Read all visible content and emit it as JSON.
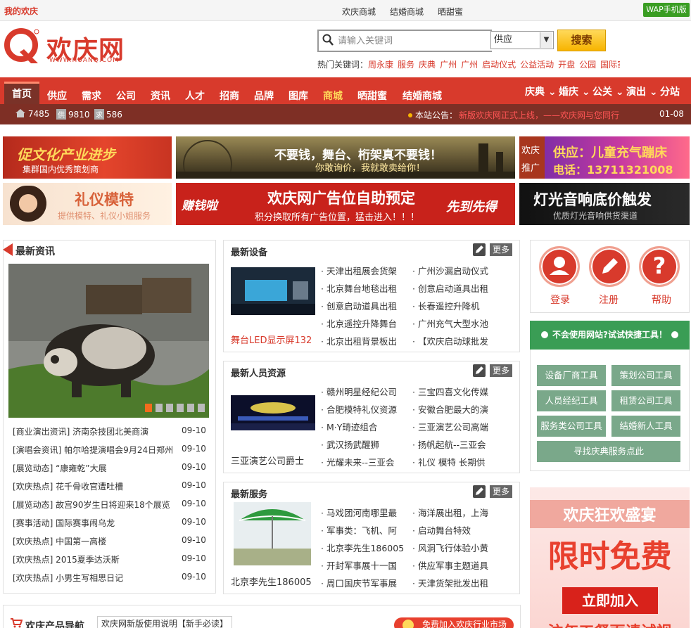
{
  "topbar": {
    "my_label": "我的欢庆",
    "links": [
      "欢庆商城",
      "结婚商城",
      "晒甜蜜"
    ],
    "wap": "WAP手机版"
  },
  "logo": {
    "text": "欢庆网",
    "url": "WWW.HUANQ.COM"
  },
  "search": {
    "placeholder": "请输入关键词",
    "category": "供应",
    "button": "搜索",
    "hot_label": "热门关键词：",
    "hot_keywords": [
      "周永康",
      "服务",
      "庆典",
      "广州",
      "广州",
      "启动仪式",
      "公益活动",
      "开盘",
      "公园",
      "国际家居"
    ]
  },
  "nav": {
    "items": [
      "首页",
      "供应",
      "需求",
      "公司",
      "资讯",
      "人才",
      "招商",
      "品牌",
      "图库",
      "商城",
      "晒甜蜜",
      "结婚商城"
    ],
    "right": [
      "庆典",
      "婚庆",
      "公关",
      "演出",
      "分站"
    ]
  },
  "stats": {
    "members": "7485",
    "supply_badge": "供",
    "supply": "9810",
    "demand_badge": "求",
    "demand": "586",
    "notice_label": "本站公告：",
    "notice_text": "新版欢庆网正式上线，——欢庆网与您同行",
    "notice_date": "01-08"
  },
  "banners": {
    "b1_title": "促文化产业进步",
    "b1_sub": "集群国内优秀策划商",
    "b2_title": "不要钱，舞台、桁架真不要钱！",
    "b2_sub": "你敢询价，我就敢卖给你！",
    "b3_tag1": "欢庆",
    "b3_tag2": "推广",
    "b3_title": "供应：儿童充气蹦床",
    "b3_sub": "电话：13711321008",
    "b4_title": "礼仪模特",
    "b4_sub": "提供模特、礼仪小姐服务",
    "b5_left": "赚钱啦",
    "b5_title": "欢庆网广告位自助预定",
    "b5_sub": "积分换取所有广告位置，猛击进入！！！",
    "b5_right": "先到先得",
    "b6_title": "灯光音响底价触发",
    "b6_sub": "优质灯光音响供货渠道"
  },
  "news": {
    "title": "最新资讯",
    "rows": [
      {
        "text": "[商业演出资讯] 济南杂技团北美商演",
        "date": "09-10"
      },
      {
        "text": "[演唱会资讯] 帕尔哈提演唱会9月24日郑州",
        "date": "09-10"
      },
      {
        "text": "[展览动态] “康雍乾”大展",
        "date": "09-10"
      },
      {
        "text": "[欢庆热点] 花千骨收官遭吐槽",
        "date": "09-10"
      },
      {
        "text": "[展览动态] 故宫90岁生日将迎来18个展览",
        "date": "09-10"
      },
      {
        "text": "[赛事活动] 国际赛事闹乌龙",
        "date": "09-10"
      },
      {
        "text": "[欢庆热点] 中国第一高楼",
        "date": "09-10"
      },
      {
        "text": "[欢庆热点] 2015夏季达沃斯",
        "date": "09-10"
      },
      {
        "text": "[欢庆热点] 小男生写相思日记",
        "date": "09-10"
      }
    ]
  },
  "equipment": {
    "title": "最新设备",
    "more": "更多",
    "caption": "舞台LED显示屏132",
    "col1": [
      "天津出租展会货架",
      "北京舞台地毯出租",
      "创意启动道具出租",
      "北京遥控升降舞台",
      "北京出租背景板出"
    ],
    "col2": [
      "广州沙漏启动仪式",
      "创意启动道具出租",
      "长春遥控升降机",
      "广州充气大型水池",
      "【欢庆启动球批发"
    ]
  },
  "people": {
    "title": "最新人员资源",
    "more": "更多",
    "caption": "三亚演艺公司爵士",
    "col1": [
      "赣州明星经纪公司",
      "合肥模特礼仪资源",
      "M·Y琦迹组合",
      "武汉扬武醒狮",
      "光耀未来--三亚会"
    ],
    "col2": [
      "三宝四喜文化传媒",
      "安徽合肥最大的演",
      "三亚演艺公司高端",
      "扬帆起航--三亚会",
      "礼仪 模特 长期供"
    ]
  },
  "services": {
    "title": "最新服务",
    "more": "更多",
    "caption": "北京李先生186005",
    "col1": [
      "马戏团河南哪里最",
      "军事类：飞机、阿",
      "北京李先生186005",
      "开封军事展十一国",
      "周口国庆节军事展"
    ],
    "col2": [
      "海洋展出租，上海",
      "启动舞台特效",
      "风洞飞行体验小黄",
      "供应军事主题道具",
      "天津货架批发出租"
    ]
  },
  "account": {
    "login": "登录",
    "register": "注册",
    "help": "帮助"
  },
  "tools": {
    "banner": "不会使用网站?试试快捷工具！",
    "items": [
      "设备厂商工具",
      "策划公司工具",
      "人员经纪工具",
      "租赁公司工具",
      "服务类公司工具",
      "结婚新人工具"
    ],
    "wide": "寻找庆典服务点此"
  },
  "promo": {
    "line1": "欢庆狂欢盛宴",
    "line2": "限时免费",
    "button": "立即加入",
    "line3": "注年工餐面请试视"
  },
  "footer": {
    "title": "欢庆产品导航",
    "tab": "欢庆网新版使用说明【新手必读】",
    "join": "免费加入欢庆行业市场"
  }
}
